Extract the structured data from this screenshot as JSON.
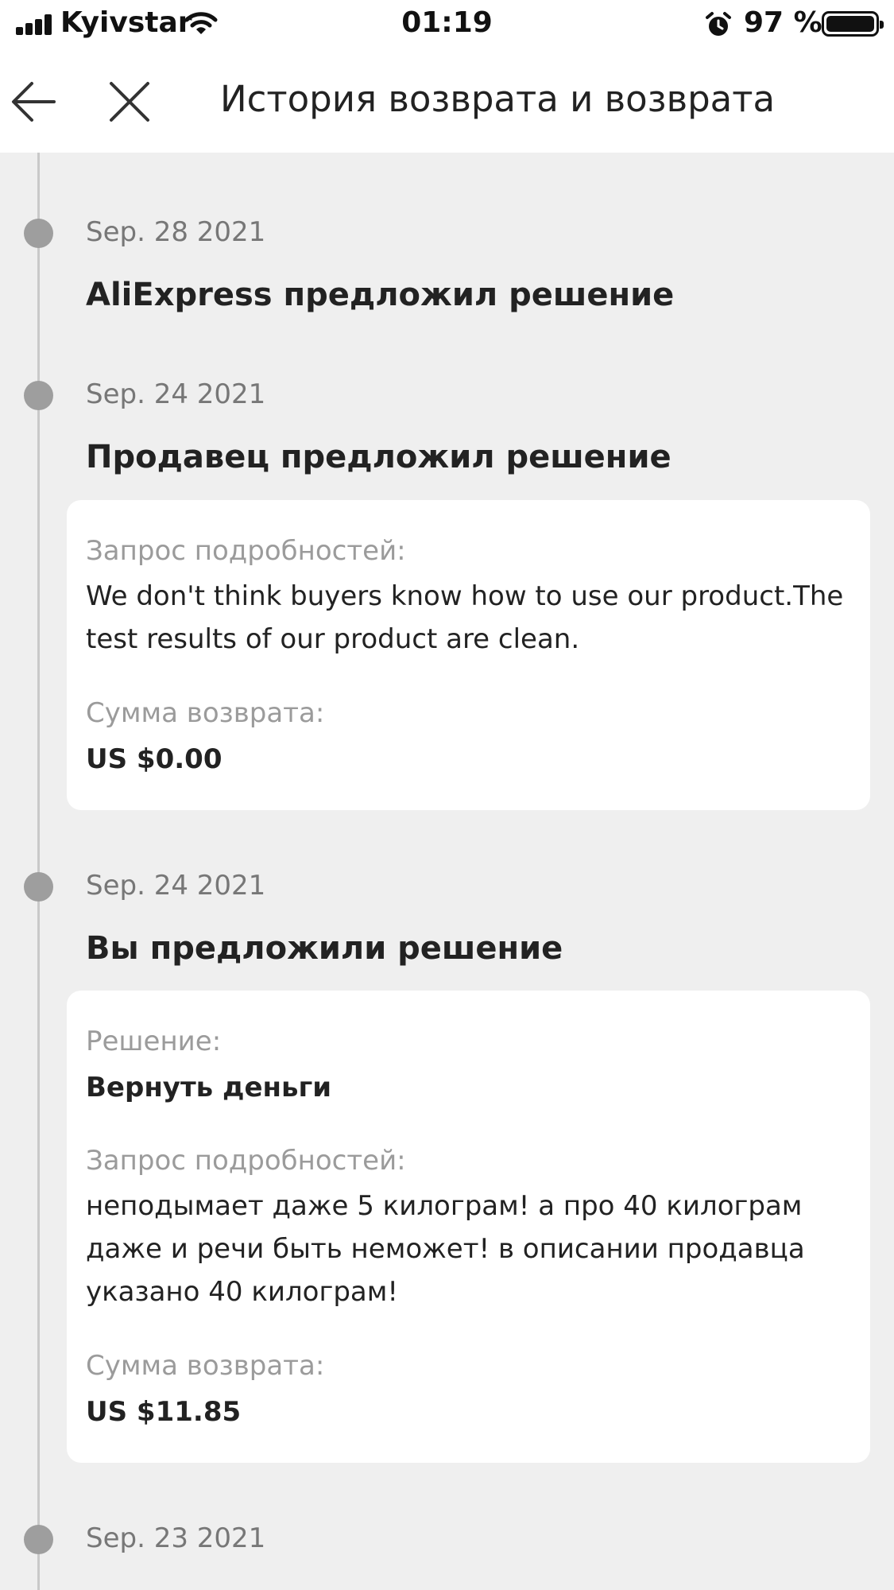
{
  "status_bar": {
    "carrier": "Kyivstar",
    "time": "01:19",
    "battery": "97 %"
  },
  "header": {
    "title": "История возврата и возврата",
    "back_icon": "arrow-left-icon",
    "close_icon": "close-icon"
  },
  "timeline": [
    {
      "date": "Sep. 28 2021",
      "title": "AliExpress предложил решение"
    },
    {
      "date": "Sep. 24 2021",
      "title": "Продавец предложил решение",
      "card": {
        "details_label": "Запрос подробностей:",
        "details_lines": [
          "We don't think buyers know how to use our product.The",
          "test results of our product are clean."
        ],
        "refund_label": "Сумма возврата:",
        "refund_value": "US $0.00"
      }
    },
    {
      "date": "Sep. 24 2021",
      "title": "Вы предложили решение",
      "card": {
        "solution_label": "Решение:",
        "solution_value": "Вернуть деньги",
        "details_label": "Запрос подробностей:",
        "details_lines": [
          "неподымает даже 5 килограм! а про 40 килограм",
          "даже и речи быть неможет! в описании продавца",
          "указано 40 килограм!"
        ],
        "refund_label": "Сумма возврата:",
        "refund_value": "US $11.85"
      }
    },
    {
      "date": "Sep. 23 2021"
    }
  ]
}
